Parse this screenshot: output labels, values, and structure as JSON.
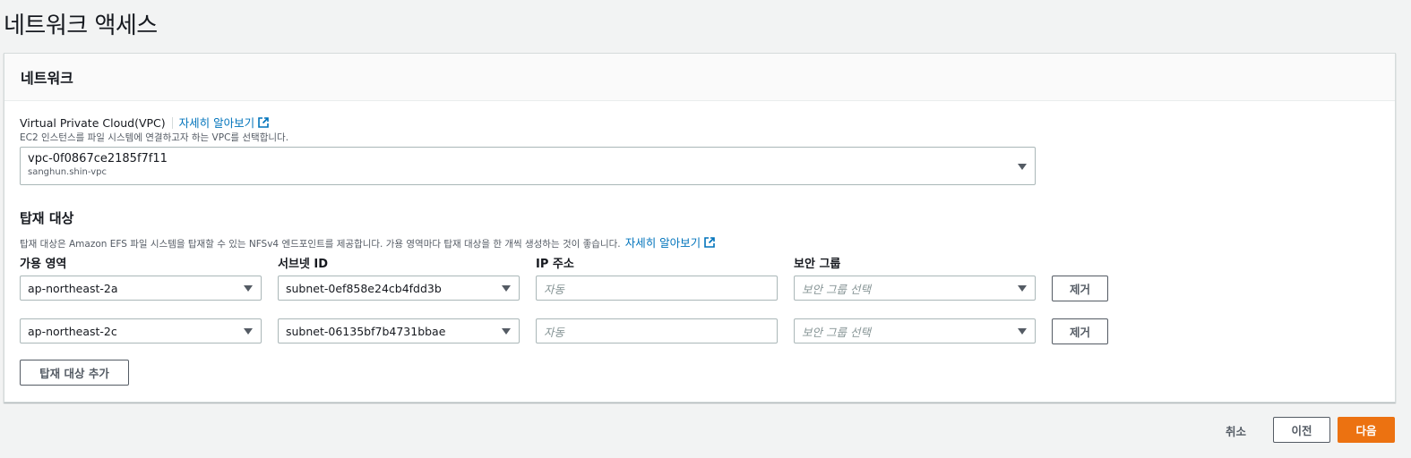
{
  "page": {
    "title": "네트워크 액세스"
  },
  "network_section": {
    "title": "네트워크"
  },
  "vpc": {
    "label": "Virtual Private Cloud(VPC)",
    "learn_more": "자세히 알아보기",
    "description": "EC2 인스턴스를 파일 시스템에 연결하고자 하는 VPC를 선택합니다.",
    "selected_id": "vpc-0f0867ce2185f7f11",
    "selected_name": "sanghun.shin-vpc"
  },
  "mount_targets": {
    "title": "탑재 대상",
    "description": "탑재 대상은 Amazon EFS 파일 시스템을 탑재할 수 있는 NFSv4 엔드포인트를 제공합니다. 가용 영역마다 탑재 대상을 한 개씩 생성하는 것이 좋습니다.",
    "learn_more": "자세히 알아보기",
    "columns": {
      "az": "가용 영역",
      "subnet": "서브넷 ID",
      "ip": "IP 주소",
      "sg": "보안 그룹"
    },
    "rows": [
      {
        "az": "ap-northeast-2a",
        "subnet": "subnet-0ef858e24cb4fdd3b",
        "ip_placeholder": "자동",
        "sg_placeholder": "보안 그룹 선택",
        "remove": "제거"
      },
      {
        "az": "ap-northeast-2c",
        "subnet": "subnet-06135bf7b4731bbae",
        "ip_placeholder": "자동",
        "sg_placeholder": "보안 그룹 선택",
        "remove": "제거"
      }
    ],
    "add_button": "탑재 대상 추가"
  },
  "footer": {
    "cancel": "취소",
    "previous": "이전",
    "next": "다음"
  },
  "colors": {
    "accent": "#ec7211",
    "link": "#0073bb"
  }
}
